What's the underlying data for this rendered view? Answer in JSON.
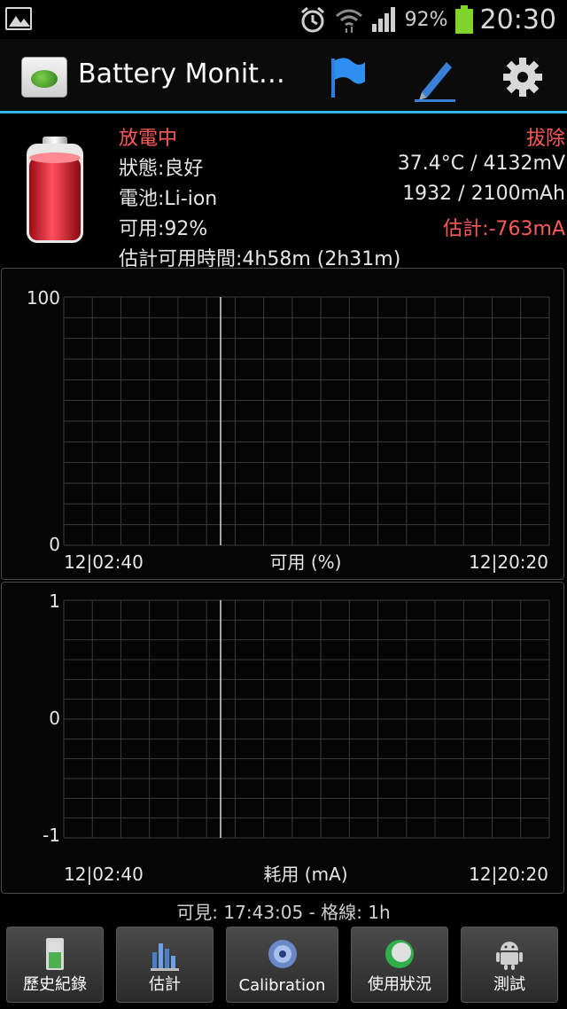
{
  "status_bar": {
    "battery_percent": "92%",
    "time": "20:30"
  },
  "action_bar": {
    "title": "Battery Monit…",
    "accent_color": "#33b5e5"
  },
  "info": {
    "state": "放電中",
    "plug": "拔除",
    "health": "狀態:良好",
    "temp_voltage": "37.4°C / 4132mV",
    "battery_type": "電池:Li-ion",
    "capacity": "1932 / 2100mAh",
    "available": "可用:92%",
    "estimate_current": "估計:-763mA",
    "estimated_time": "估計可用時間:4h58m (2h31m)"
  },
  "charts": {
    "available": {
      "y_max": "100",
      "y_min": "0",
      "x_start": "12|02:40",
      "x_end": "12|20:20",
      "label": "可用 (%)"
    },
    "consumption": {
      "y_max": "1",
      "y_mid": "0",
      "y_min": "-1",
      "x_start": "12|02:40",
      "x_end": "12|20:20",
      "label": "耗用 (mA)"
    }
  },
  "chart_data": [
    {
      "type": "line",
      "ylabel": "可用 (%)",
      "ylim": [
        0,
        100
      ],
      "x_ticks": [
        "12|02:40",
        "12|20:20"
      ],
      "grid": true,
      "series": []
    },
    {
      "type": "line",
      "ylabel": "耗用 (mA)",
      "ylim": [
        -1,
        1
      ],
      "y_ticks": [
        -1,
        0,
        1
      ],
      "x_ticks": [
        "12|02:40",
        "12|20:20"
      ],
      "grid": true,
      "series": []
    }
  ],
  "footer": {
    "visible_grid": "可見: 17:43:05 - 格線: 1h"
  },
  "buttons": [
    {
      "label": "歷史紀錄",
      "icon": "history-icon"
    },
    {
      "label": "估計",
      "icon": "estimate-icon"
    },
    {
      "label": "Calibration",
      "icon": "calibration-icon"
    },
    {
      "label": "使用狀況",
      "icon": "usage-icon"
    },
    {
      "label": "測試",
      "icon": "android-icon"
    }
  ]
}
